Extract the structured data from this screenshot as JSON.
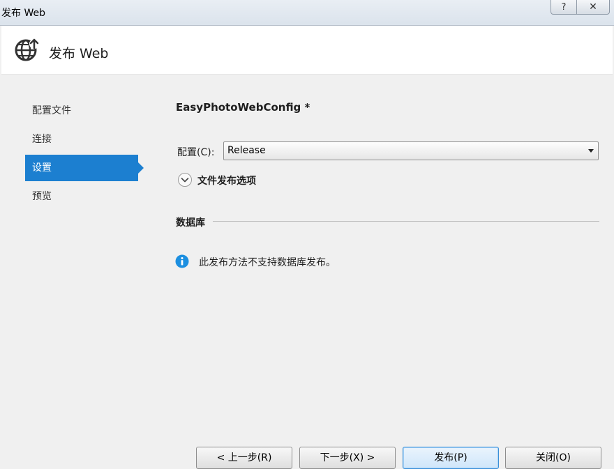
{
  "window": {
    "title": "发布 Web",
    "help_label": "?",
    "close_label": "✕"
  },
  "header": {
    "title": "发布 Web",
    "icon": "globe-publish-icon"
  },
  "nav": {
    "items": [
      {
        "label": "配置文件"
      },
      {
        "label": "连接"
      },
      {
        "label": "设置",
        "active": true
      },
      {
        "label": "预览"
      }
    ]
  },
  "main": {
    "profile_title": "EasyPhotoWebConfig *",
    "config_label": "配置(C):",
    "config_value": "Release",
    "file_options_label": "文件发布选项",
    "database_label": "数据库",
    "info_text": "此发布方法不支持数据库发布。"
  },
  "footer": {
    "prev_label": "< 上一步(R)",
    "next_label": "下一步(X) >",
    "publish_label": "发布(P)",
    "close_label": "关闭(O)"
  },
  "colors": {
    "accent": "#1c7fd0",
    "info": "#1c8fe0"
  }
}
